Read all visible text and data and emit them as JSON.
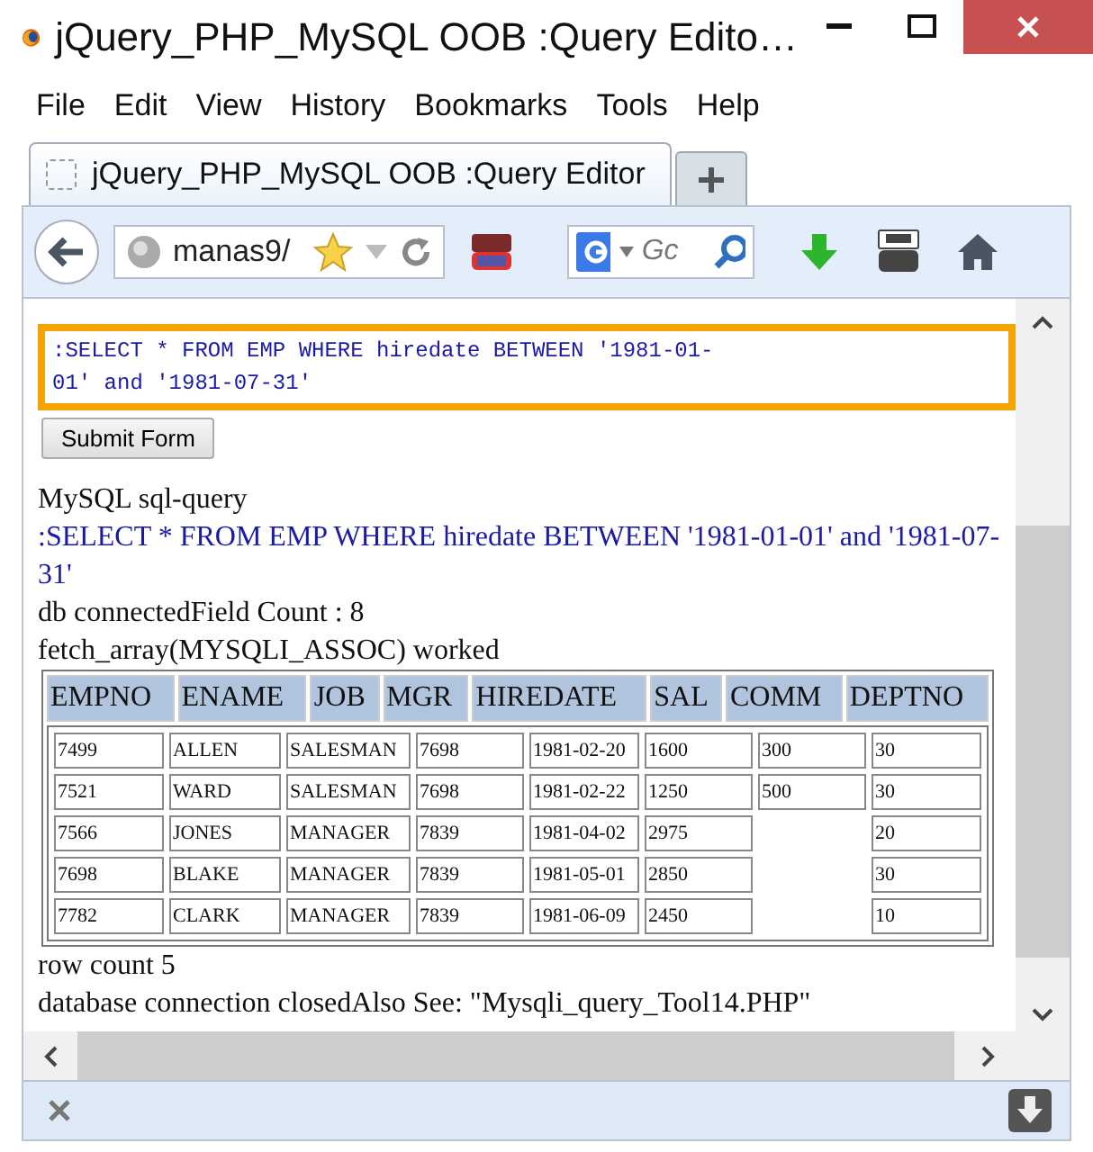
{
  "window": {
    "title": "jQuery_PHP_MySQL OOB :Query Edito…"
  },
  "menu": [
    {
      "label": "File"
    },
    {
      "label": "Edit"
    },
    {
      "label": "View"
    },
    {
      "label": "History"
    },
    {
      "label": "Bookmarks"
    },
    {
      "label": "Tools"
    },
    {
      "label": "Help"
    }
  ],
  "tabs": [
    {
      "label": "jQuery_PHP_MySQL OOB :Query Editor",
      "selected": true
    }
  ],
  "navbar": {
    "address": "manas9/",
    "search_placeholder": "Gc"
  },
  "form": {
    "query": ":SELECT * FROM EMP WHERE hiredate BETWEEN '1981-01-01' and '1981-07-31' ",
    "focused": true,
    "submit": "Submit Form"
  },
  "output_before": [
    {
      "kind": "plain",
      "text": "MySQL sql-query"
    },
    {
      "kind": "query",
      "text": ":SELECT * FROM EMP WHERE hiredate BETWEEN '1981-01-01' and '1981-07-31'"
    },
    {
      "kind": "plain",
      "text": "db connectedField Count : 8"
    },
    {
      "kind": "plain",
      "text": "fetch_array(MYSQLI_ASSOC) worked"
    }
  ],
  "table": {
    "columns": [
      "EMPNO",
      "ENAME",
      "JOB",
      "MGR",
      "HIREDATE",
      "SAL",
      "COMM",
      "DEPTNO"
    ],
    "rows": [
      [
        "7499",
        "ALLEN",
        "SALESMAN",
        "7698",
        "1981-02-20",
        "1600",
        "300",
        "30"
      ],
      [
        "7521",
        "WARD",
        "SALESMAN",
        "7698",
        "1981-02-22",
        "1250",
        "500",
        "30"
      ],
      [
        "7566",
        "JONES",
        "MANAGER",
        "7839",
        "1981-04-02",
        "2975",
        null,
        "20"
      ],
      [
        "7698",
        "BLAKE",
        "MANAGER",
        "7839",
        "1981-05-01",
        "2850",
        null,
        "30"
      ],
      [
        "7782",
        "CLARK",
        "MANAGER",
        "7839",
        "1981-06-09",
        "2450",
        null,
        "10"
      ]
    ]
  },
  "output_after": [
    {
      "kind": "plain",
      "text": "row count 5"
    },
    {
      "kind": "plain",
      "text": "database connection closedAlso See: \"Mysqli_query_Tool14.PHP\""
    }
  ]
}
